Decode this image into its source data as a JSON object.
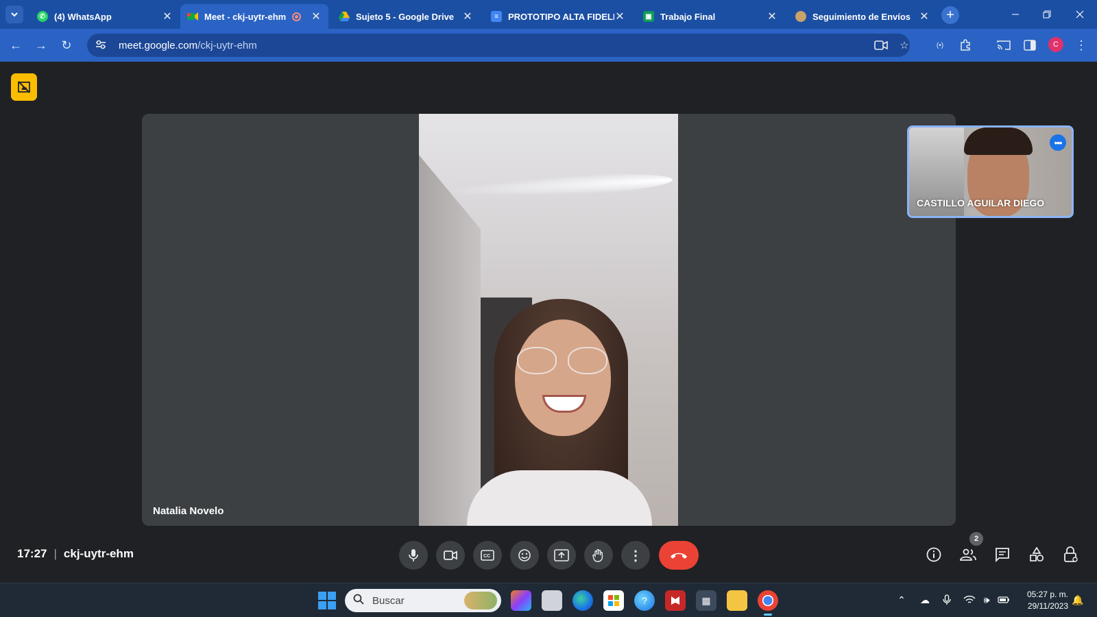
{
  "browser": {
    "tabs": [
      {
        "label": "(4) WhatsApp",
        "icon": "whatsapp-icon",
        "color": "#25d366"
      },
      {
        "label": "Meet - ckj-uytr-ehm",
        "icon": "google-meet-icon",
        "color": "#00897b",
        "active": true,
        "recording": true
      },
      {
        "label": "Sujeto 5 - Google Drive",
        "icon": "google-drive-icon",
        "color": "#fbbc04"
      },
      {
        "label": "PROTOTIPO ALTA FIDELID",
        "icon": "google-docs-icon",
        "color": "#4285f4"
      },
      {
        "label": "Trabajo Final",
        "icon": "google-classroom-icon",
        "color": "#0f9d58"
      },
      {
        "label": "Seguimiento de Envíos",
        "icon": "site-favicon-icon",
        "color": "#c9a26b"
      }
    ],
    "address": {
      "host": "meet.google.com",
      "path": "/ckj-uytr-ehm"
    },
    "profile_initial": "C"
  },
  "meet": {
    "main_participant": "Natalia Novelo",
    "self_participant": "CASTILLO AGUILAR DIEGO",
    "time": "17:27",
    "meeting_code": "ckj-uytr-ehm",
    "participant_count": "2",
    "accent_red": "#ea4335",
    "self_border": "#8ab4f8"
  },
  "taskbar": {
    "search_placeholder": "Buscar",
    "time": "05:27 p. m.",
    "date": "29/11/2023"
  }
}
